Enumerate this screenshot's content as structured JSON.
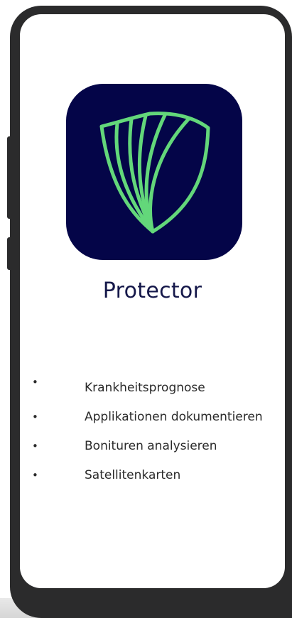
{
  "app": {
    "name": "Protector",
    "icon": "shield-leaf-logo",
    "colors": {
      "icon_background": "#040548",
      "icon_stroke": "#63d77a",
      "title_text": "#15184a"
    }
  },
  "features": [
    {
      "label": "Krankheitsprognose"
    },
    {
      "label": "Applikationen dokumentieren"
    },
    {
      "label": "Bonituren analysieren"
    },
    {
      "label": "Satellitenkarten"
    }
  ],
  "bullet_char": "•"
}
